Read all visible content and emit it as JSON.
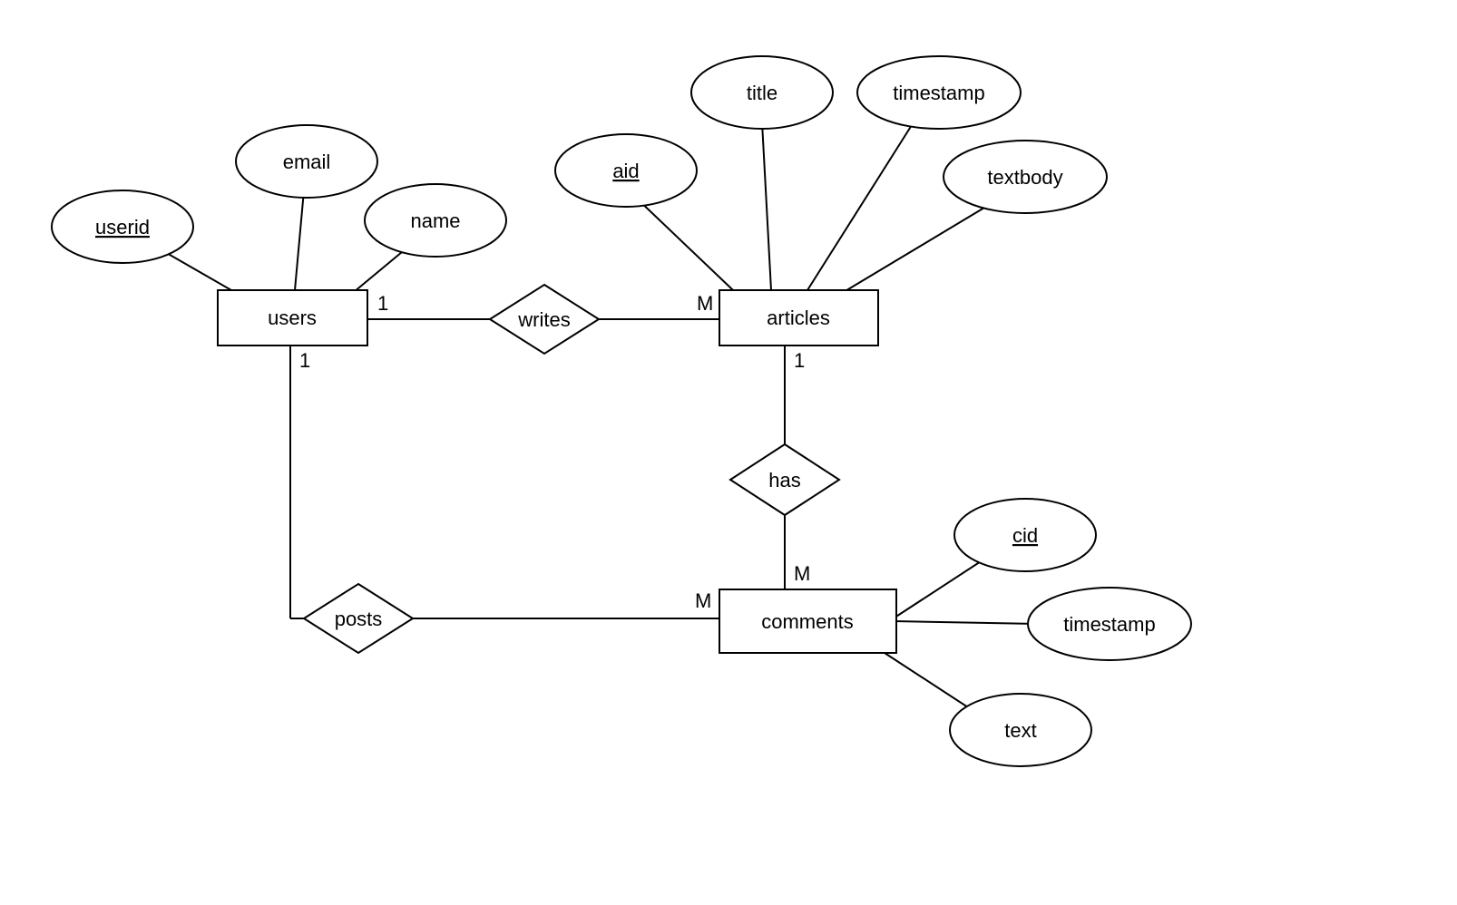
{
  "entities": {
    "users": {
      "label": "users"
    },
    "articles": {
      "label": "articles"
    },
    "comments": {
      "label": "comments"
    }
  },
  "relationships": {
    "writes": {
      "label": "writes"
    },
    "posts": {
      "label": "posts"
    },
    "has": {
      "label": "has"
    }
  },
  "attributes": {
    "userid": {
      "label": "userid",
      "key": true
    },
    "email": {
      "label": "email",
      "key": false
    },
    "name": {
      "label": "name",
      "key": false
    },
    "aid": {
      "label": "aid",
      "key": true
    },
    "title": {
      "label": "title",
      "key": false
    },
    "timestamp_article": {
      "label": "timestamp",
      "key": false
    },
    "textbody": {
      "label": "textbody",
      "key": false
    },
    "cid": {
      "label": "cid",
      "key": true
    },
    "timestamp_comment": {
      "label": "timestamp",
      "key": false
    },
    "text": {
      "label": "text",
      "key": false
    }
  },
  "cardinalities": {
    "users_writes": "1",
    "writes_articles": "M",
    "users_posts": "1",
    "posts_comments": "M",
    "articles_has": "1",
    "has_comments": "M"
  }
}
